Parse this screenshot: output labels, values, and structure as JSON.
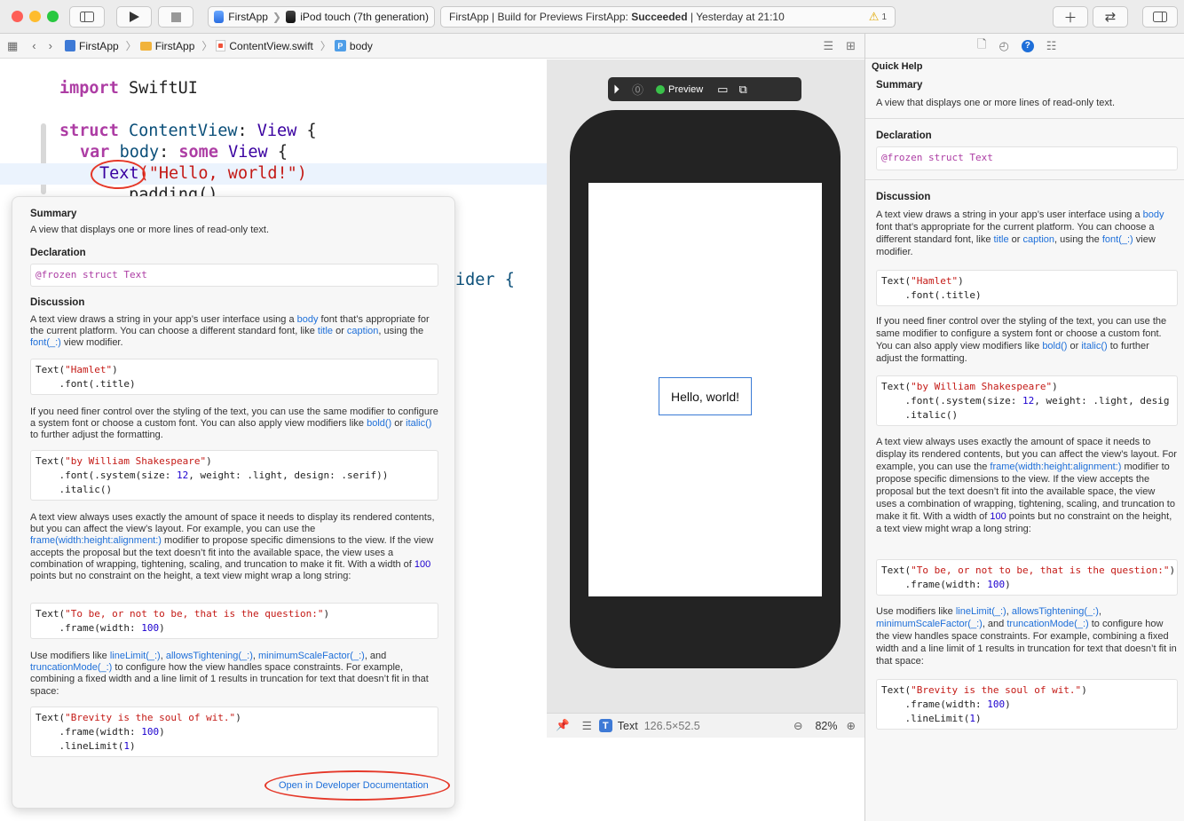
{
  "toolbar": {
    "scheme": {
      "app": "FirstApp",
      "device": "iPod touch (7th generation)"
    },
    "activity": {
      "prefix": "FirstApp | Build for Previews FirstApp:",
      "status": "Succeeded",
      "suffix": "| Yesterday at 21:10",
      "warning_count": "1"
    }
  },
  "breadcrumb": [
    "FirstApp",
    "FirstApp",
    "ContentView.swift",
    "body"
  ],
  "editor": {
    "lines": {
      "import_kw": "import",
      "import_mod": "SwiftUI",
      "struct_kw": "struct",
      "struct_name": "ContentView",
      "colon": ":",
      "view_type": "View",
      "brace": "{",
      "var_kw": "var",
      "body_name": "body",
      "some_kw": "some",
      "view2": "View",
      "brace2": "{",
      "text_call": "Text",
      "text_arg": "(\"Hello, world!\")",
      "padding": ".padding()",
      "provider_tail": "ider {"
    }
  },
  "popover": {
    "summary_h": "Summary",
    "summary": "A view that displays one or more lines of read-only text.",
    "declaration_h": "Declaration",
    "decl_attr": "@frozen",
    "decl_rest": "struct Text",
    "discussion_h": "Discussion",
    "p1a": "A text view draws a string in your app’s user interface using a ",
    "p1_body": "body",
    "p1b": " font that’s appropriate for the current platform. You can choose a different standard font, like ",
    "p1_title": "title",
    "p1c": " or ",
    "p1_caption": "caption",
    "p1d": ", using the ",
    "p1_font": "font(_:)",
    "p1e": " view modifier.",
    "code1_a": "Text(",
    "code1_str": "\"Hamlet\"",
    "code1_b": ")",
    "code1_l2": "    .font(.title)",
    "p2a": "If you need finer control over the styling of the text, you can use the same modifier to configure a system font or choose a custom font. You can also apply view modifiers like ",
    "p2_bold": "bold()",
    "p2b": " or ",
    "p2_italic": "italic()",
    "p2c": " to further adjust the formatting.",
    "code2_a": "Text(",
    "code2_str": "\"by William Shakespeare\"",
    "code2_b": ")",
    "code2_l2a": "    .font(.system(size: ",
    "code2_num": "12",
    "code2_l2b": ", weight: .light, design: .serif))",
    "code2_l3": "    .italic()",
    "p3a": "A text view always uses exactly the amount of space it needs to display its rendered contents, but you can affect the view’s layout. For example, you can use the ",
    "p3_frame": "frame(width:height:alignment:)",
    "p3b": " modifier to propose specific dimensions to the view. If the view accepts the proposal but the text doesn’t fit into the available space, the view uses a combination of wrapping, tightening, scaling, and truncation to make it fit. With a width of ",
    "p3_100": "100",
    "p3c": " points but no constraint on the height, a text view might wrap a long string:",
    "code3_a": "Text(",
    "code3_str": "\"To be, or not to be, that is the question:\"",
    "code3_b": ")",
    "code3_l2a": "    .frame(width: ",
    "code3_num": "100",
    "code3_l2b": ")",
    "p4a": "Use modifiers like ",
    "p4_ll": "lineLimit(_:)",
    "p4_c1": ", ",
    "p4_at": "allowsTightening(_:)",
    "p4_c2": ", ",
    "p4_msf": "minimumScaleFactor(_:)",
    "p4b": ", and ",
    "p4_tm": "truncationMode(_:)",
    "p4c": " to configure how the view handles space constraints. For example, combining a fixed width and a line limit of ",
    "p4_1": "1",
    "p4d": " results in truncation for text that doesn’t fit in that space:",
    "code4_a": "Text(",
    "code4_str": "\"Brevity is the soul of wit.\"",
    "code4_b": ")",
    "code4_l2a": "    .frame(width: ",
    "code4_num": "100",
    "code4_l2b": ")",
    "code4_l3a": "    .lineLimit(",
    "code4_num2": "1",
    "code4_l3b": ")",
    "open_docs": "Open in Developer Documentation"
  },
  "preview": {
    "label": "Preview",
    "hello": "Hello, world!",
    "selected_type": "Text",
    "selected_size": "126.5×52.5",
    "zoom": "82%"
  },
  "inspector": {
    "title": "Quick Help",
    "p1a": "A text view draws a string in your app’s user interface using a ",
    "p1b": " font that’s appropriate for the current platform. You can choose a different standard font, like ",
    "p1c": " or ",
    "p1d": ", using the ",
    "p1e": " view modifier.",
    "p2a": "If you need finer control over the styling of the text, you can use the same modifier to configure a system font or choose a custom font. You can also apply view modifiers like ",
    "p2b": " or ",
    "p2c": " to further adjust the formatting.",
    "code2_l2b": ", weight: .light, desig",
    "p3a": "A text view always uses exactly the amount of space it needs to display its rendered contents, but you can affect the view’s layout. For example, you can use the ",
    "p3b": " modifier to propose specific dimensions to the view. If the view accepts the proposal but the text doesn’t fit into the available space, the view uses a combination of wrapping, tightening, scaling, and truncation to make it fit. With a width of ",
    "p3c": " points but no constraint on the height, a text view might wrap a long string:",
    "code3_str": "\"To be, or not to be, that is the question:\"",
    "p4a": "Use modifiers like ",
    "p4b": ", and ",
    "p4c": " to configure how the view handles space constraints. For example, combining a fixed width and a line limit of ",
    "p4d": " results in truncation for text that doesn’t fit in that space:"
  }
}
